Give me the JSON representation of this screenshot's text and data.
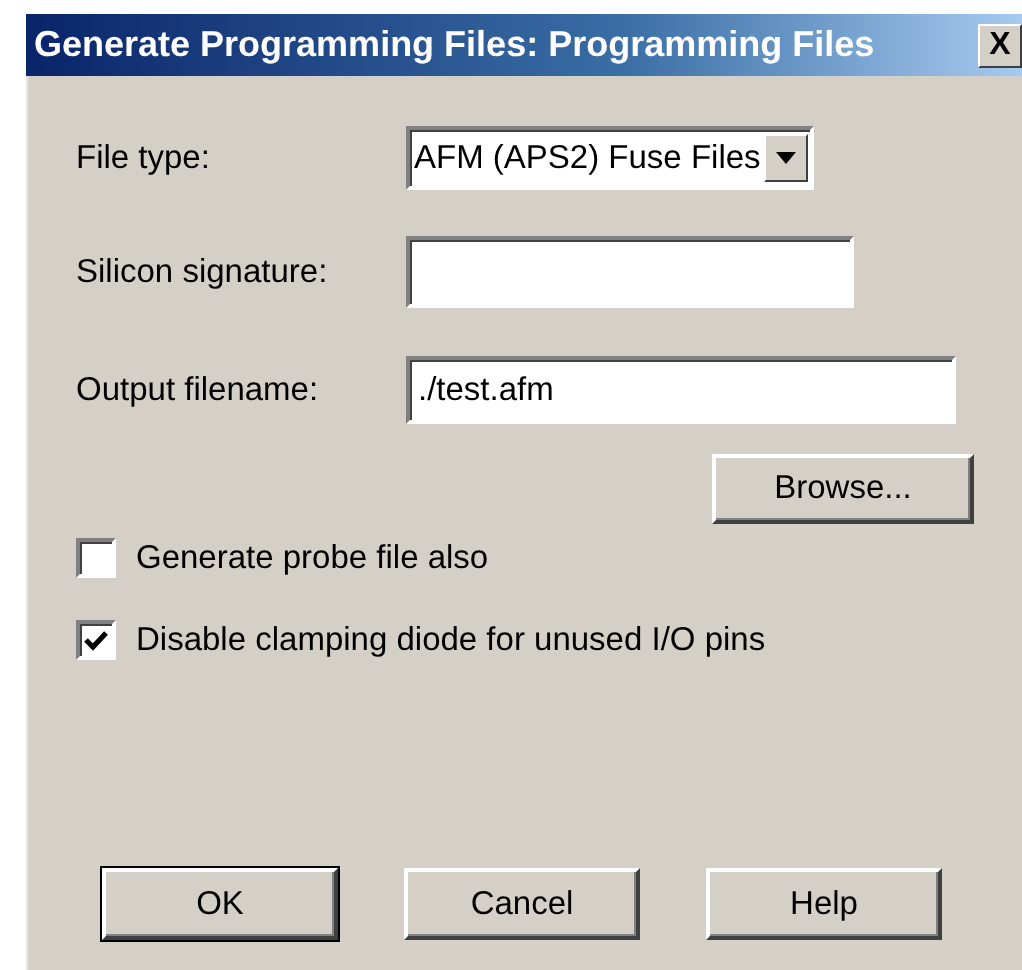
{
  "window": {
    "title": "Generate Programming Files: Programming Files",
    "close_label": "X"
  },
  "fields": [
    {
      "kind": "dropdown",
      "label": "File type:",
      "value": "AFM (APS2) Fuse Files"
    },
    {
      "kind": "text",
      "label": "Silicon signature:"
    },
    {
      "kind": "text",
      "label": "Output filename:",
      "value": "./test.afm"
    }
  ],
  "browse_button": "Browse...",
  "checkboxes": [
    {
      "label": "Generate probe file also",
      "checked": false
    },
    {
      "label": "Disable clamping diode for unused I/O pins",
      "checked": true
    }
  ],
  "buttons": [
    {
      "label": "OK",
      "default": true
    },
    {
      "label": "Cancel",
      "default": false
    },
    {
      "label": "Help",
      "default": false
    }
  ]
}
